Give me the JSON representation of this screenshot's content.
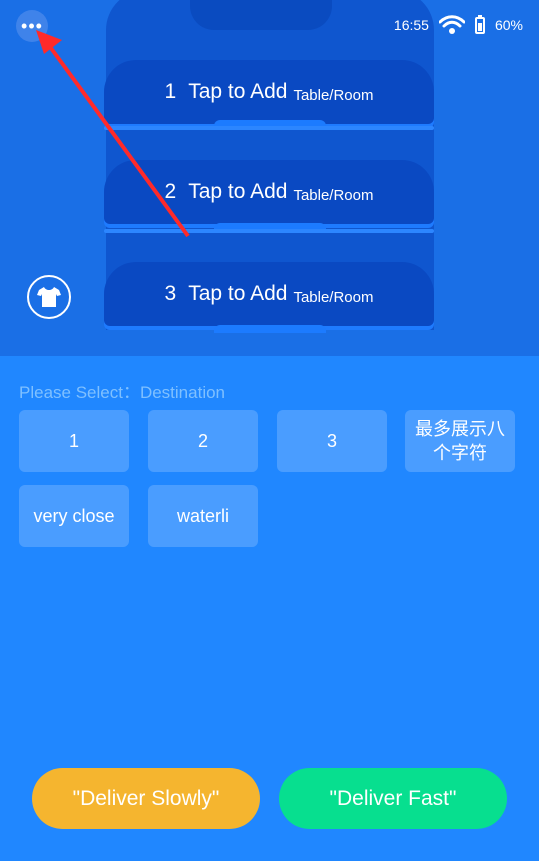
{
  "status_bar": {
    "time": "16:55",
    "battery": "60%",
    "icons": [
      "wifi-icon",
      "battery-icon"
    ]
  },
  "trays": [
    {
      "number": "1",
      "label": "Tap to Add",
      "sub": "Table/Room"
    },
    {
      "number": "2",
      "label": "Tap to Add",
      "sub": "Table/Room"
    },
    {
      "number": "3",
      "label": "Tap to Add",
      "sub": "Table/Room"
    }
  ],
  "select": {
    "label": "Please Select：Destination",
    "options": [
      "1",
      "2",
      "3",
      "最多展示八个字符",
      "very close",
      "waterli"
    ]
  },
  "actions": {
    "slow": "\"Deliver Slowly\"",
    "fast": "\"Deliver Fast\""
  },
  "colors": {
    "top_bg": "#1a6fe6",
    "page_bg": "#2087ff",
    "tray": "#0a49c2",
    "option": "#4a9dff",
    "slow_button": "#f5b52f",
    "fast_button": "#07df8f",
    "arrow": "#ff2a2a"
  }
}
